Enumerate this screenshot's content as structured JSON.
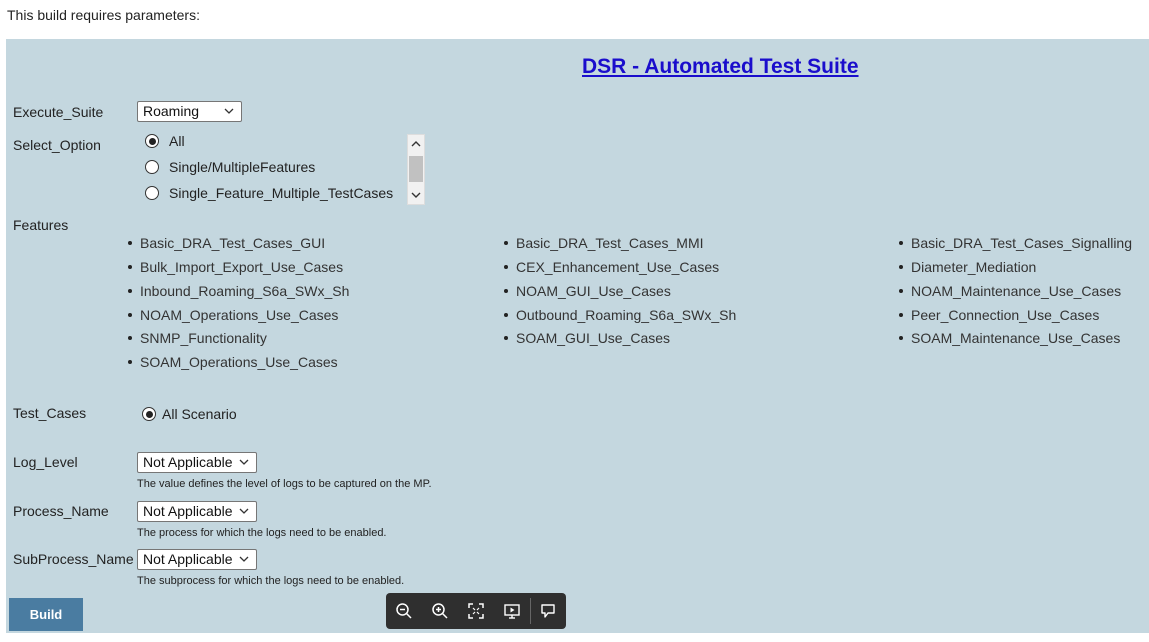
{
  "intro": "This build requires parameters:",
  "title": "DSR - Automated Test Suite",
  "execute_suite": {
    "label": "Execute_Suite",
    "value": "Roaming"
  },
  "select_option": {
    "label": "Select_Option",
    "options": [
      "All",
      "Single/MultipleFeatures",
      "Single_Feature_Multiple_TestCases"
    ],
    "selected": "All"
  },
  "features": {
    "label": "Features",
    "items": [
      "Basic_DRA_Test_Cases_GUI",
      "Basic_DRA_Test_Cases_MMI",
      "Basic_DRA_Test_Cases_Signalling",
      "Bulk_Import_Export_Use_Cases",
      "CEX_Enhancement_Use_Cases",
      "Diameter_Mediation",
      "Inbound_Roaming_S6a_SWx_Sh",
      "NOAM_GUI_Use_Cases",
      "NOAM_Maintenance_Use_Cases",
      "NOAM_Operations_Use_Cases",
      "Outbound_Roaming_S6a_SWx_Sh",
      "Peer_Connection_Use_Cases",
      "SNMP_Functionality",
      "SOAM_GUI_Use_Cases",
      "SOAM_Maintenance_Use_Cases",
      "SOAM_Operations_Use_Cases"
    ]
  },
  "test_cases": {
    "label": "Test_Cases",
    "option": "All Scenario"
  },
  "log_level": {
    "label": "Log_Level",
    "value": "Not Applicable",
    "help": "The value defines the level of logs to be captured on the MP."
  },
  "process_name": {
    "label": "Process_Name",
    "value": "Not Applicable",
    "help": "The process for which the logs need to be enabled."
  },
  "subprocess_name": {
    "label": "SubProcess_Name",
    "value": "Not Applicable",
    "help": "The subprocess for which the logs need to be enabled."
  },
  "build_button": "Build",
  "toolbar": {
    "icons": [
      "zoom-out-icon",
      "zoom-in-icon",
      "fit-screen-icon",
      "presentation-icon",
      "comment-icon"
    ]
  },
  "colors": {
    "panel_bg": "#c4d7df",
    "title_link": "#1a0dcc",
    "build_button": "#4a7ca1",
    "toolbar_bg": "#2f2f2f"
  }
}
